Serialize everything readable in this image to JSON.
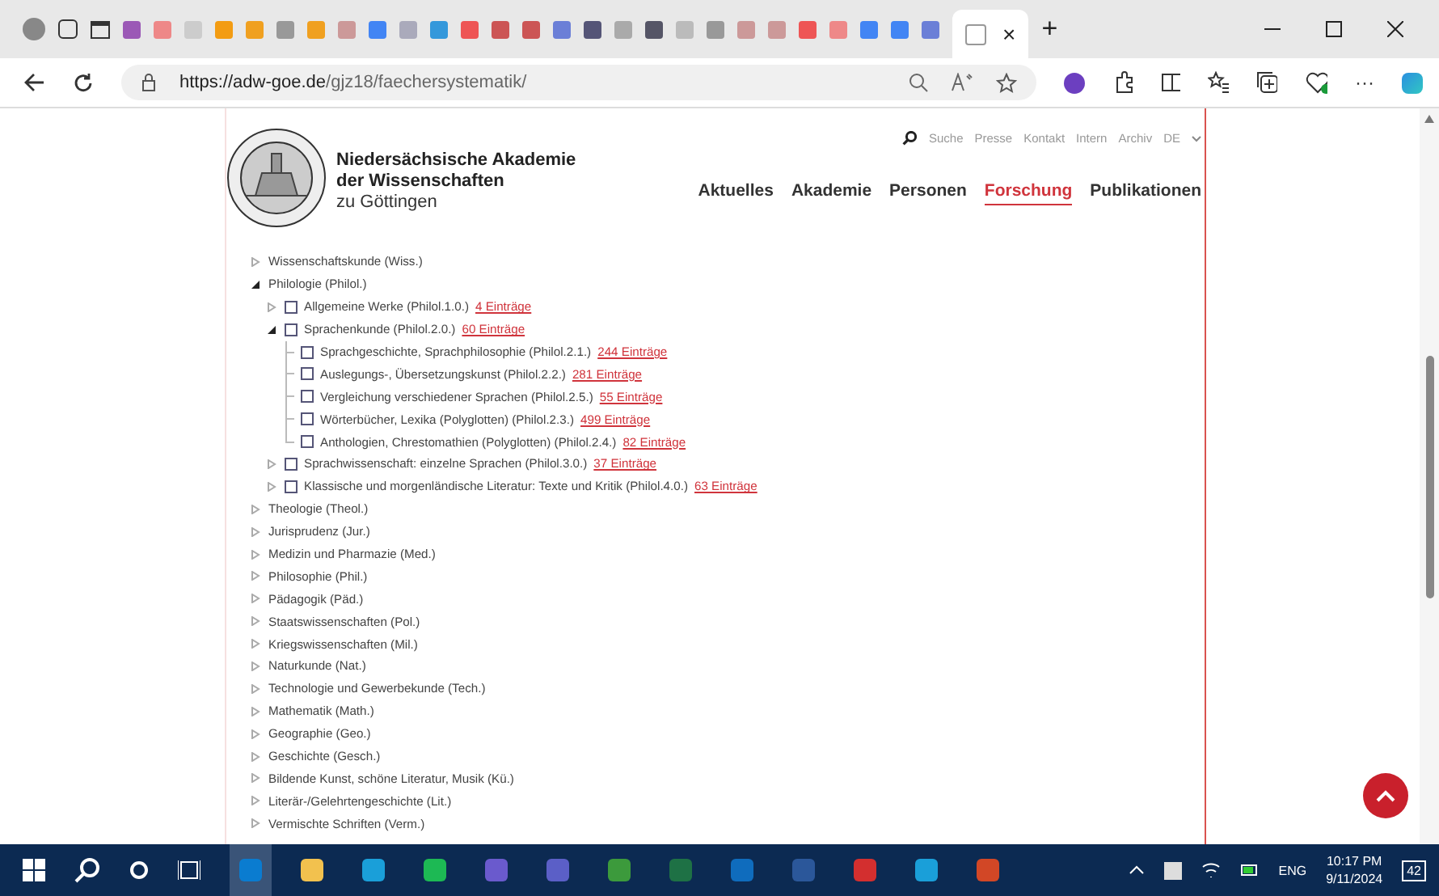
{
  "browser": {
    "tab_close": "×",
    "new_tab": "+",
    "url_host": "https://adw-goe.de",
    "url_path": "/gjz18/faechersystematik/",
    "more": "···"
  },
  "header": {
    "title_lines": [
      "Niedersächsische Akademie",
      "der Wissenschaften"
    ],
    "subtitle": "zu Göttingen",
    "utility_links": [
      {
        "label": "Suche"
      },
      {
        "label": "Presse"
      },
      {
        "label": "Kontakt"
      },
      {
        "label": "Intern"
      },
      {
        "label": "Archiv"
      },
      {
        "label": "DE"
      }
    ],
    "nav": [
      {
        "label": "Aktuelles",
        "selected": false
      },
      {
        "label": "Akademie",
        "selected": false
      },
      {
        "label": "Personen",
        "selected": false
      },
      {
        "label": "Forschung",
        "selected": true
      },
      {
        "label": "Publikationen",
        "selected": false
      }
    ]
  },
  "tree": [
    {
      "label": "Wissenschaftskunde (Wiss.)",
      "expanded": false
    },
    {
      "label": "Philologie (Philol.)",
      "expanded": true,
      "children": [
        {
          "label": "Allgemeine Werke (Philol.1.0.)",
          "count": "4 Einträge",
          "expanded": false,
          "checked": false
        },
        {
          "label": "Sprachenkunde (Philol.2.0.)",
          "count": "60 Einträge",
          "expanded": true,
          "checked": false,
          "children": [
            {
              "label": "Sprachgeschichte, Sprachphilosophie (Philol.2.1.)",
              "count": "244 Einträge",
              "checked": false
            },
            {
              "label": "Auslegungs-, Übersetzungskunst (Philol.2.2.)",
              "count": "281 Einträge",
              "checked": false
            },
            {
              "label": "Vergleichung verschiedener Sprachen (Philol.2.5.)",
              "count": "55 Einträge",
              "checked": false
            },
            {
              "label": "Wörterbücher, Lexika (Polyglotten) (Philol.2.3.)",
              "count": "499 Einträge",
              "checked": false
            },
            {
              "label": "Anthologien, Chrestomathien (Polyglotten) (Philol.2.4.)",
              "count": "82 Einträge",
              "checked": false
            }
          ]
        },
        {
          "label": "Sprachwissenschaft: einzelne Sprachen (Philol.3.0.)",
          "count": "37 Einträge",
          "expanded": false,
          "checked": false
        },
        {
          "label": "Klassische und morgenländische Literatur: Texte und Kritik (Philol.4.0.)",
          "count": "63 Einträge",
          "expanded": false,
          "checked": false
        }
      ]
    },
    {
      "label": "Theologie (Theol.)",
      "expanded": false
    },
    {
      "label": "Jurisprudenz (Jur.)",
      "expanded": false
    },
    {
      "label": "Medizin und Pharmazie (Med.)",
      "expanded": false
    },
    {
      "label": "Philosophie (Phil.)",
      "expanded": false
    },
    {
      "label": "Pädagogik (Päd.)",
      "expanded": false
    },
    {
      "label": "Staatswissenschaften (Pol.)",
      "expanded": false
    },
    {
      "label": "Kriegswissenschaften (Mil.)",
      "expanded": false
    },
    {
      "label": "Naturkunde (Nat.)",
      "expanded": false
    },
    {
      "label": "Technologie und Gewerbekunde (Tech.)",
      "expanded": false
    },
    {
      "label": "Mathematik (Math.)",
      "expanded": false
    },
    {
      "label": "Geographie (Geo.)",
      "expanded": false
    },
    {
      "label": "Geschichte (Gesch.)",
      "expanded": false
    },
    {
      "label": "Bildende Kunst, schöne Literatur, Musik (Kü.)",
      "expanded": false
    },
    {
      "label": "Literär-/Gelehrtengeschichte (Lit.)",
      "expanded": false
    },
    {
      "label": "Vermischte Schriften (Verm.)",
      "expanded": false
    }
  ],
  "taskbar": {
    "tray_language": "ENG",
    "time": "10:17 PM",
    "date": "9/11/2024",
    "notification_count": "42"
  }
}
